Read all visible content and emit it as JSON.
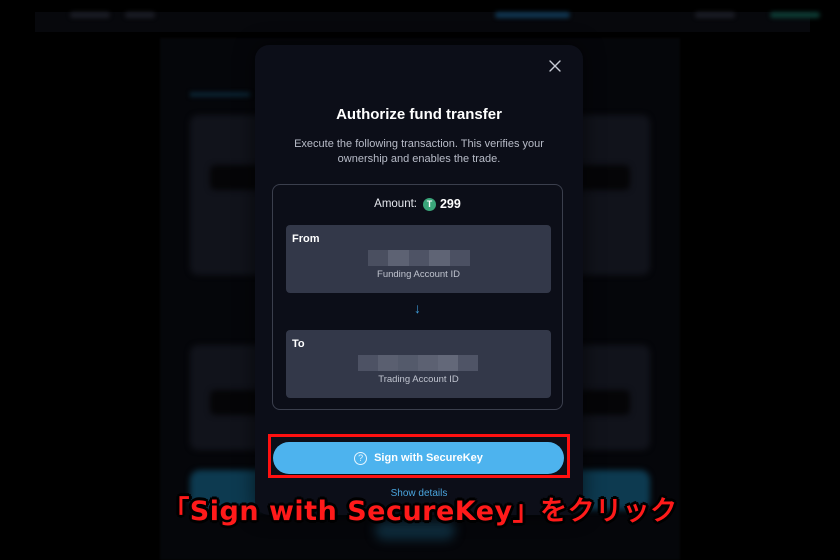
{
  "modal": {
    "title": "Authorize fund transfer",
    "description": "Execute the following transaction. This verifies your ownership and enables the trade.",
    "close_icon": "close-icon",
    "transaction": {
      "amount_label": "Amount:",
      "token_icon": "usdt-token-icon",
      "token_glyph": "T",
      "amount_value": "299",
      "from": {
        "title": "From",
        "account_id": "redacted",
        "subtitle": "Funding Account ID"
      },
      "arrow": "↓",
      "to": {
        "title": "To",
        "account_id": "redacted",
        "subtitle": "Trading Account ID"
      }
    },
    "sign_button": {
      "icon": "help-icon",
      "icon_glyph": "?",
      "label": "Sign with SecureKey"
    },
    "show_details_label": "Show details"
  },
  "annotation": {
    "caption": "「Sign with SecureKey」をクリック",
    "highlight_color": "#ff1010"
  },
  "colors": {
    "modal_bg": "#0c0e18",
    "card_bg": "#333849",
    "accent": "#4db3ee",
    "token_green": "#3aa57a",
    "arrow_blue": "#3d9bd8"
  }
}
